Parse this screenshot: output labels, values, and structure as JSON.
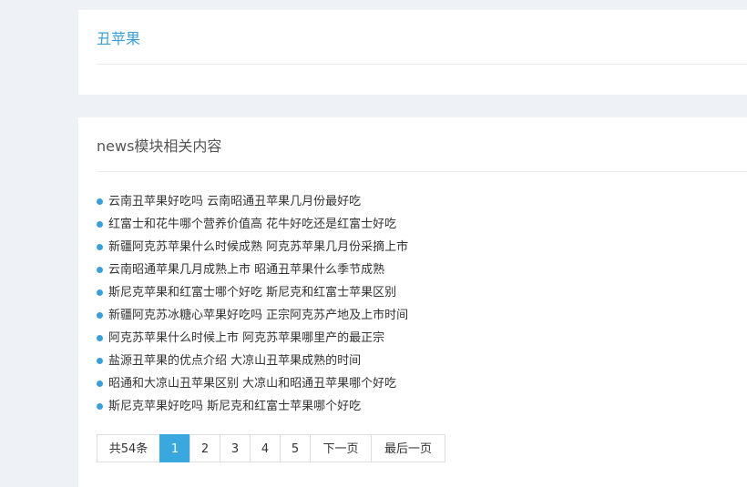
{
  "tag": {
    "title": "丑苹果"
  },
  "related": {
    "title": "news模块相关内容",
    "items": [
      "云南丑苹果好吃吗 云南昭通丑苹果几月份最好吃",
      "红富士和花牛哪个营养价值高 花牛好吃还是红富士好吃",
      "新疆阿克苏苹果什么时候成熟 阿克苏苹果几月份采摘上市",
      "云南昭通苹果几月成熟上市 昭通丑苹果什么季节成熟",
      "斯尼克苹果和红富士哪个好吃 斯尼克和红富士苹果区别",
      "新疆阿克苏冰糖心苹果好吃吗 正宗阿克苏产地及上市时间",
      "阿克苏苹果什么时候上市 阿克苏苹果哪里产的最正宗",
      "盐源丑苹果的优点介绍 大凉山丑苹果成熟的时间",
      "昭通和大凉山丑苹果区别 大凉山和昭通丑苹果哪个好吃",
      "斯尼克苹果好吃吗 斯尼克和红富士苹果哪个好吃"
    ]
  },
  "pagination": {
    "total_label": "共54条",
    "pages": [
      "1",
      "2",
      "3",
      "4",
      "5"
    ],
    "current_page": "1",
    "next_label": "下一页",
    "last_label": "最后一页"
  },
  "colors": {
    "accent": "#3aa7de",
    "background": "#eef1f5"
  }
}
